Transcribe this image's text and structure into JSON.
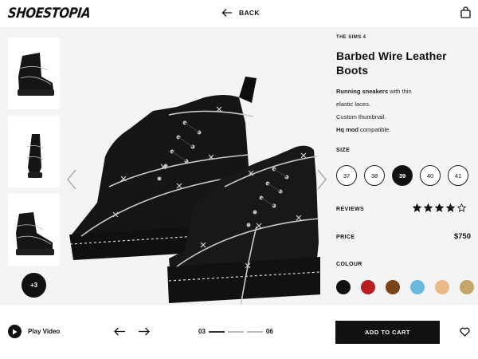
{
  "header": {
    "logo": "SHOESTOPIA",
    "back_label": "BACK"
  },
  "gallery": {
    "more_label": "+3"
  },
  "product": {
    "kicker": "THE SIMS 4",
    "title": "Barbed Wire Leather Boots",
    "desc_line1_bold": "Running sneakers",
    "desc_line1_rest": " with thin",
    "desc_line2": "elastic laces.",
    "desc_line3": "Custom thumbnail.",
    "desc_line4_bold": "Hq mod",
    "desc_line4_rest": " compatible.",
    "size_label": "SIZE",
    "sizes": [
      "37",
      "38",
      "39",
      "40",
      "41"
    ],
    "selected_size": "39",
    "reviews_label": "REVIEWS",
    "rating": 4,
    "rating_max": 5,
    "price_label": "PRICE",
    "price": "$750",
    "colour_label": "COLOUR",
    "colours": [
      "#111111",
      "#b81e22",
      "#7a4419",
      "#6bb8de",
      "#e9b988",
      "#c4a467"
    ]
  },
  "footer": {
    "play_label": "Play Video",
    "page_current": "03",
    "page_total": "06",
    "cart_label": "ADD TO CART"
  },
  "icons": {
    "back": "arrow-left-icon",
    "bag": "shopping-bag-icon",
    "prev": "chevron-left-icon",
    "next": "chevron-right-icon",
    "play": "play-icon",
    "heart": "heart-icon",
    "star": "star-icon"
  }
}
